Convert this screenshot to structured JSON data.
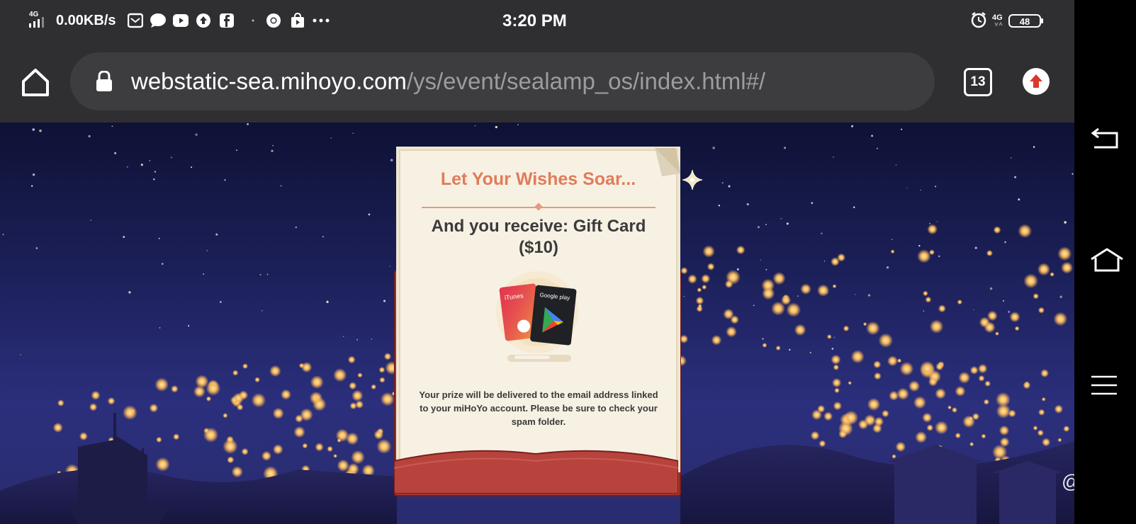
{
  "status_bar": {
    "network": "4G",
    "speed": "0.00KB/s",
    "time": "3:20 PM",
    "network_right": "4G",
    "battery": "48",
    "notification_icons": [
      "mail-icon",
      "chat-icon",
      "youtube-icon",
      "upload-icon",
      "facebook-icon",
      "chrome-icon",
      "store-icon",
      "more-icon"
    ]
  },
  "browser": {
    "url_domain": "webstatic-sea.mihoyo.com",
    "url_path": "/ys/event/sealamp_os/index.html#/",
    "tab_count": "13"
  },
  "modal": {
    "title": "Let Your Wishes Soar...",
    "prize_line1": "And you receive: Gift Card",
    "prize_line2": "($10)",
    "card_itunes": "iTunes",
    "card_google": "Google play",
    "note": "Your prize will be delivered to the email address linked to your miHoYo account. Please be sure to check your spam folder."
  },
  "watermark": "@Xen",
  "colors": {
    "title_accent": "#e07c5a",
    "envelope_red": "#a6352f",
    "letter_bg": "#f7f1e4",
    "chrome_bar": "#2f2f31"
  }
}
